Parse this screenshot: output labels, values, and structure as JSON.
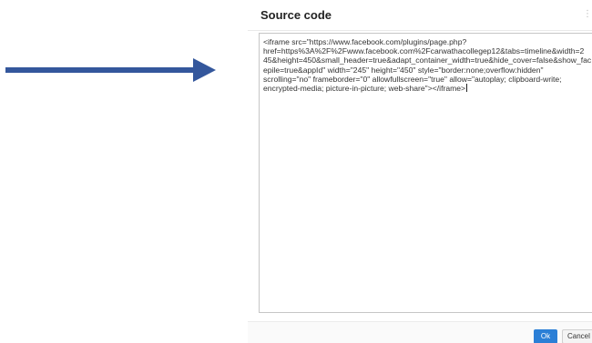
{
  "dialog": {
    "title": "Source code",
    "close_icon": "close-icon",
    "code_lines": [
      "<iframe src=\"https://www.facebook.com/plugins/page.php?",
      "href=https%3A%2F%2Fwww.facebook.com%2Fcarwathacollegep12&tabs=timeline&width=2",
      "45&height=450&small_header=true&adapt_container_width=true&hide_cover=false&show_fac",
      "epile=true&appId\" width=\"245\" height=\"450\" style=\"border:none;overflow:hidden\"",
      "scrolling=\"no\" frameborder=\"0\" allowfullscreen=\"true\" allow=\"autoplay; clipboard-write;",
      "encrypted-media; picture-in-picture; web-share\"></iframe>"
    ],
    "ok_label": "Ok",
    "cancel_label": "Cancel"
  },
  "annotations": {
    "arrow_color": "#34579c",
    "arrow_icon": "arrow-right-icon",
    "ok_color": "#2b7fd6"
  }
}
